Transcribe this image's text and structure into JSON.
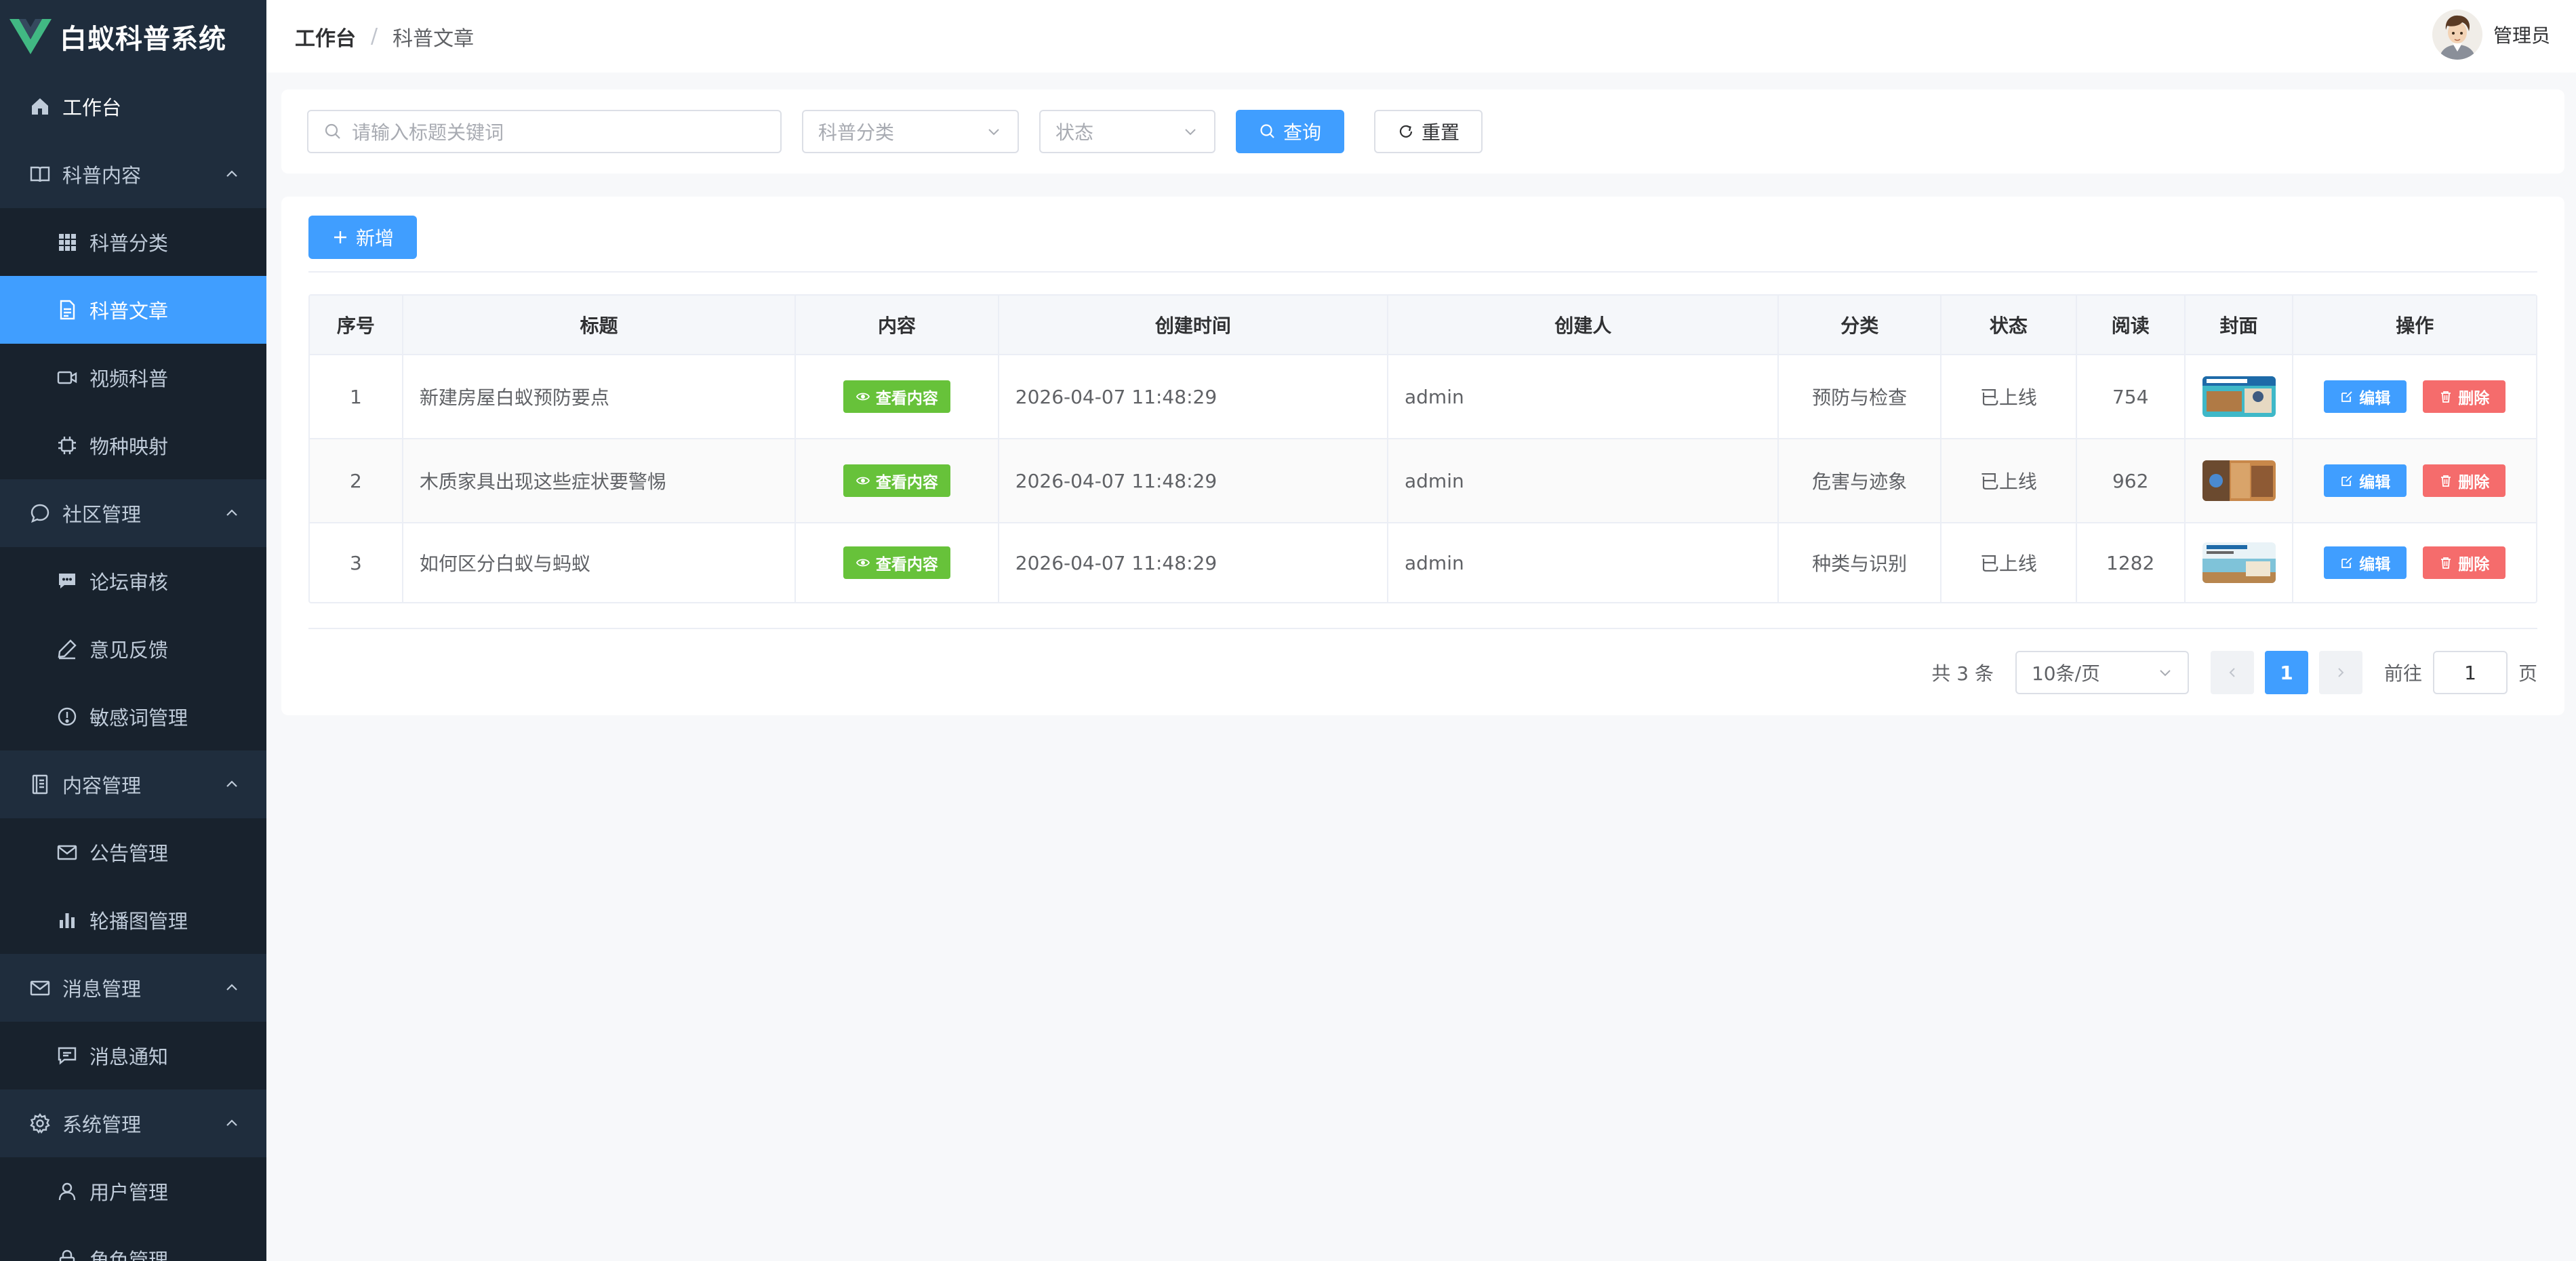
{
  "app": {
    "title": "白蚁科普系统"
  },
  "header": {
    "breadcrumb": [
      "工作台",
      "科普文章"
    ],
    "breadcrumb_separator": "/",
    "user_name": "管理员"
  },
  "sidebar": {
    "items": [
      {
        "label": "工作台",
        "icon": "home-icon"
      },
      {
        "label": "科普内容",
        "icon": "book-icon"
      },
      {
        "label": "科普分类",
        "icon": "grid-icon"
      },
      {
        "label": "科普文章",
        "icon": "document-icon"
      },
      {
        "label": "视频科普",
        "icon": "video-icon"
      },
      {
        "label": "物种映射",
        "icon": "chip-icon"
      },
      {
        "label": "社区管理",
        "icon": "chat-bubble-icon"
      },
      {
        "label": "论坛审核",
        "icon": "message-icon"
      },
      {
        "label": "意见反馈",
        "icon": "pen-icon"
      },
      {
        "label": "敏感词管理",
        "icon": "warning-icon"
      },
      {
        "label": "内容管理",
        "icon": "notebook-icon"
      },
      {
        "label": "公告管理",
        "icon": "mail-icon"
      },
      {
        "label": "轮播图管理",
        "icon": "bar-chart-icon"
      },
      {
        "label": "消息管理",
        "icon": "mail-icon"
      },
      {
        "label": "消息通知",
        "icon": "chat-square-icon"
      },
      {
        "label": "系统管理",
        "icon": "gear-icon"
      },
      {
        "label": "用户管理",
        "icon": "user-icon"
      },
      {
        "label": "角色管理",
        "icon": "lock-icon"
      }
    ]
  },
  "search": {
    "keyword_placeholder": "请输入标题关键词",
    "category_placeholder": "科普分类",
    "status_placeholder": "状态",
    "query_label": "查询",
    "reset_label": "重置"
  },
  "toolbar": {
    "add_label": "新增"
  },
  "table": {
    "columns": [
      "序号",
      "标题",
      "内容",
      "创建时间",
      "创建人",
      "分类",
      "状态",
      "阅读",
      "封面",
      "操作"
    ],
    "view_label": "查看内容",
    "edit_label": "编辑",
    "delete_label": "删除",
    "rows": [
      {
        "index": "1",
        "title": "新建房屋白蚁预防要点",
        "created_at": "2026-04-07 11:48:29",
        "creator": "admin",
        "category": "预防与检查",
        "status": "已上线",
        "reads": "754"
      },
      {
        "index": "2",
        "title": "木质家具出现这些症状要警惕",
        "created_at": "2026-04-07 11:48:29",
        "creator": "admin",
        "category": "危害与迹象",
        "status": "已上线",
        "reads": "962"
      },
      {
        "index": "3",
        "title": "如何区分白蚁与蚂蚁",
        "created_at": "2026-04-07 11:48:29",
        "creator": "admin",
        "category": "种类与识别",
        "status": "已上线",
        "reads": "1282"
      }
    ]
  },
  "pagination": {
    "total_text": "共 3 条",
    "page_size": "10条/页",
    "current_page": "1",
    "goto_label": "前往",
    "goto_value": "1",
    "page_suffix": "页"
  },
  "colors": {
    "sidebar_bg": "#1f2d3d",
    "submenu_bg": "#18222d",
    "primary": "#409eff",
    "success": "#67c23a",
    "danger": "#f56c6c",
    "logo_green": "#41b883"
  }
}
